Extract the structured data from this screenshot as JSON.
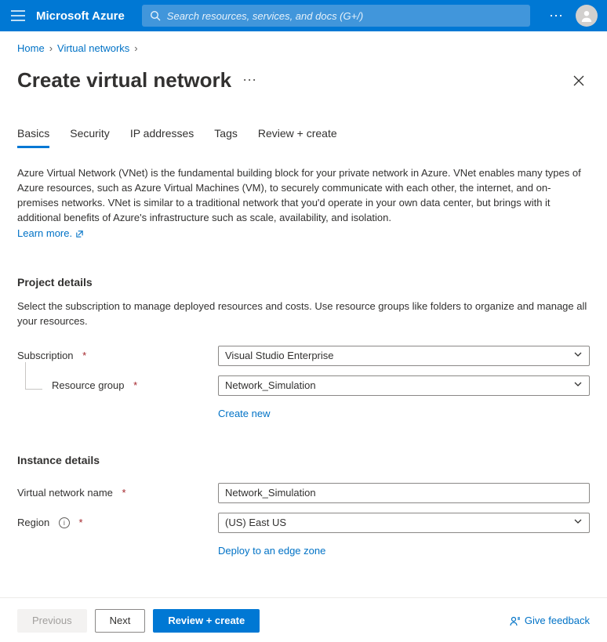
{
  "header": {
    "brand": "Microsoft Azure",
    "search_placeholder": "Search resources, services, and docs (G+/)"
  },
  "breadcrumb": {
    "home": "Home",
    "crumb1": "Virtual networks"
  },
  "page_title": "Create virtual network",
  "tabs": [
    {
      "label": "Basics",
      "active": true
    },
    {
      "label": "Security",
      "active": false
    },
    {
      "label": "IP addresses",
      "active": false
    },
    {
      "label": "Tags",
      "active": false
    },
    {
      "label": "Review + create",
      "active": false
    }
  ],
  "intro": {
    "text": "Azure Virtual Network (VNet) is the fundamental building block for your private network in Azure. VNet enables many types of Azure resources, such as Azure Virtual Machines (VM), to securely communicate with each other, the internet, and on-premises networks. VNet is similar to a traditional network that you'd operate in your own data center, but brings with it additional benefits of Azure's infrastructure such as scale, availability, and isolation.",
    "learn_more": "Learn more."
  },
  "project": {
    "heading": "Project details",
    "text": "Select the subscription to manage deployed resources and costs. Use resource groups like folders to organize and manage all your resources.",
    "subscription_label": "Subscription",
    "subscription_value": "Visual Studio Enterprise",
    "resource_group_label": "Resource group",
    "resource_group_value": "Network_Simulation",
    "create_new": "Create new"
  },
  "instance": {
    "heading": "Instance details",
    "name_label": "Virtual network name",
    "name_value": "Network_Simulation",
    "region_label": "Region",
    "region_value": "(US) East US",
    "deploy_link": "Deploy to an edge zone"
  },
  "footer": {
    "previous": "Previous",
    "next": "Next",
    "review": "Review + create",
    "feedback": "Give feedback"
  }
}
